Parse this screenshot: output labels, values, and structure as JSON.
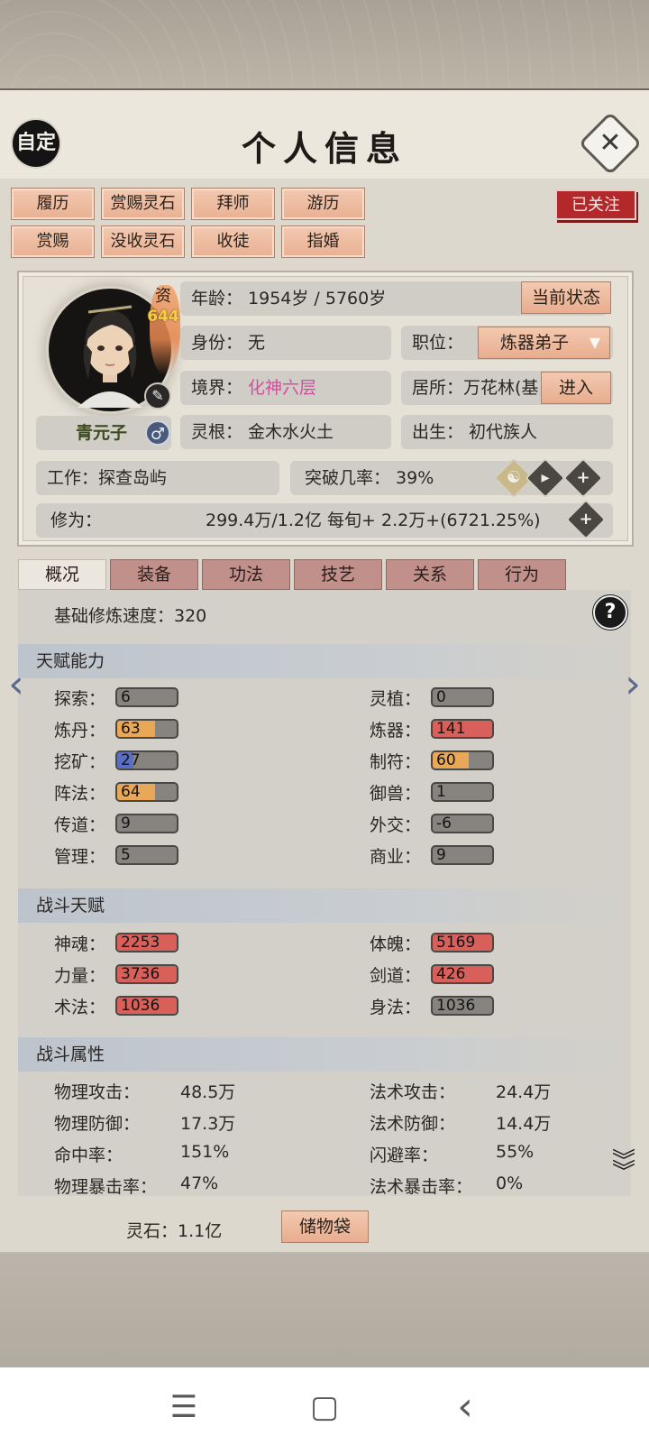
{
  "header": {
    "avatar_label": "自定",
    "title": "个人信息",
    "close_icon": "close-icon"
  },
  "actions": {
    "row1": [
      "履历",
      "赏赐灵石",
      "拜师",
      "游历"
    ],
    "row2": [
      "赏赐",
      "没收灵石",
      "收徒",
      "指婚"
    ],
    "followed": "已关注"
  },
  "profile": {
    "name": "青元子",
    "gender_symbol": "♂",
    "qualification_label": "资",
    "qualification_value": "644",
    "age": "年龄：          1954岁 / 5760岁",
    "state_button": "当前状态",
    "identity": "身份：  无",
    "position_label": "职位：",
    "position_value": "炼器弟子",
    "realm_label": "境界：  ",
    "realm_value": "化神六层",
    "residence": "居所：万花林(基",
    "enter_button": "进入",
    "spirit_root": "灵根：  金木水火土",
    "birth": "出生：  初代族人",
    "work": "工作：探查岛屿",
    "breakthrough": "突破几率：  39%",
    "cultivation_label": "修为：",
    "cultivation_value": "299.4万/1.2亿  每旬+  2.2万+(6721.25%)"
  },
  "tabs": [
    "概况",
    "装备",
    "功法",
    "技艺",
    "关系",
    "行为"
  ],
  "active_tab": 0,
  "overview": {
    "base_speed": "基础修炼速度：320",
    "talent_title": "天赋能力",
    "talents_left": [
      {
        "label": "探索：",
        "value": "6",
        "fill": 0,
        "color": "#87847f"
      },
      {
        "label": "炼丹：",
        "value": "63",
        "fill": 0.63,
        "color": "#e8a857"
      },
      {
        "label": "挖矿：",
        "value": "27",
        "fill": 0.27,
        "color": "#5a6fc4"
      },
      {
        "label": "阵法：",
        "value": "64",
        "fill": 0.64,
        "color": "#e8a857"
      },
      {
        "label": "传道：",
        "value": "9",
        "fill": 0,
        "color": "#87847f"
      },
      {
        "label": "管理：",
        "value": "5",
        "fill": 0,
        "color": "#87847f"
      }
    ],
    "talents_right": [
      {
        "label": "灵植：",
        "value": "0",
        "fill": 0,
        "color": "#87847f"
      },
      {
        "label": "炼器：",
        "value": "141",
        "fill": 1,
        "color": "#d9605a"
      },
      {
        "label": "制符：",
        "value": "60",
        "fill": 0.6,
        "color": "#e8a857"
      },
      {
        "label": "御兽：",
        "value": "1",
        "fill": 0,
        "color": "#87847f"
      },
      {
        "label": "外交：",
        "value": "-6",
        "fill": 0,
        "color": "#87847f"
      },
      {
        "label": "商业：",
        "value": "9",
        "fill": 0,
        "color": "#87847f"
      }
    ],
    "combat_title": "战斗天赋",
    "combat_left": [
      {
        "label": "神魂：",
        "value": "2253",
        "fill": 1,
        "color": "#d9605a"
      },
      {
        "label": "力量：",
        "value": "3736",
        "fill": 1,
        "color": "#d9605a"
      },
      {
        "label": "术法：",
        "value": "1036",
        "fill": 1,
        "color": "#d9605a"
      }
    ],
    "combat_right": [
      {
        "label": "体魄：",
        "value": "5169",
        "fill": 1,
        "color": "#d9605a"
      },
      {
        "label": "剑道：",
        "value": "426",
        "fill": 1,
        "color": "#d9605a"
      },
      {
        "label": "身法：",
        "value": "1036",
        "fill": 0,
        "color": "#87847f"
      }
    ],
    "attr_title": "战斗属性",
    "attrs_left": [
      {
        "label": "物理攻击：",
        "value": "48.5万"
      },
      {
        "label": "物理防御：",
        "value": "17.3万"
      },
      {
        "label": "命中率：",
        "value": "151%"
      },
      {
        "label": "物理暴击率：",
        "value": "47%"
      }
    ],
    "attrs_right": [
      {
        "label": "法术攻击：",
        "value": "24.4万"
      },
      {
        "label": "法术防御：",
        "value": "14.4万"
      },
      {
        "label": "闪避率：",
        "value": "55%"
      },
      {
        "label": "法术暴击率：",
        "value": "0%"
      }
    ]
  },
  "footer": {
    "spirit_stones": "灵石：1.1亿",
    "bag_button": "储物袋"
  },
  "system_nav": {
    "menu": "☰",
    "home": "▢",
    "back": "‹"
  }
}
